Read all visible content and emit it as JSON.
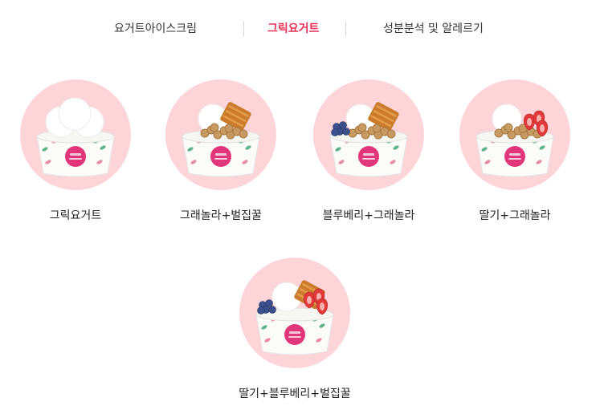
{
  "tabs": [
    {
      "label": "요거트아이스크림",
      "active": false
    },
    {
      "label": "그릭요거트",
      "active": true
    },
    {
      "label": "성분분석 및 알레르기",
      "active": false
    }
  ],
  "menu": [
    {
      "label": "그릭요거트",
      "toppings": []
    },
    {
      "label": "그래놀라+벌집꿀",
      "toppings": [
        "granola",
        "honeycomb"
      ]
    },
    {
      "label": "블루베리+그래놀라",
      "toppings": [
        "blueberry",
        "granola",
        "honeycomb"
      ]
    },
    {
      "label": "딸기+그래놀라",
      "toppings": [
        "granola",
        "strawberry"
      ]
    },
    {
      "label": "딸기+블루베리+벌집꿀",
      "toppings": [
        "blueberry",
        "strawberry",
        "honeycomb"
      ]
    }
  ],
  "colors": {
    "accent": "#e8325a",
    "circle_bg": "#fdd4d8",
    "label": "#e2367a"
  }
}
